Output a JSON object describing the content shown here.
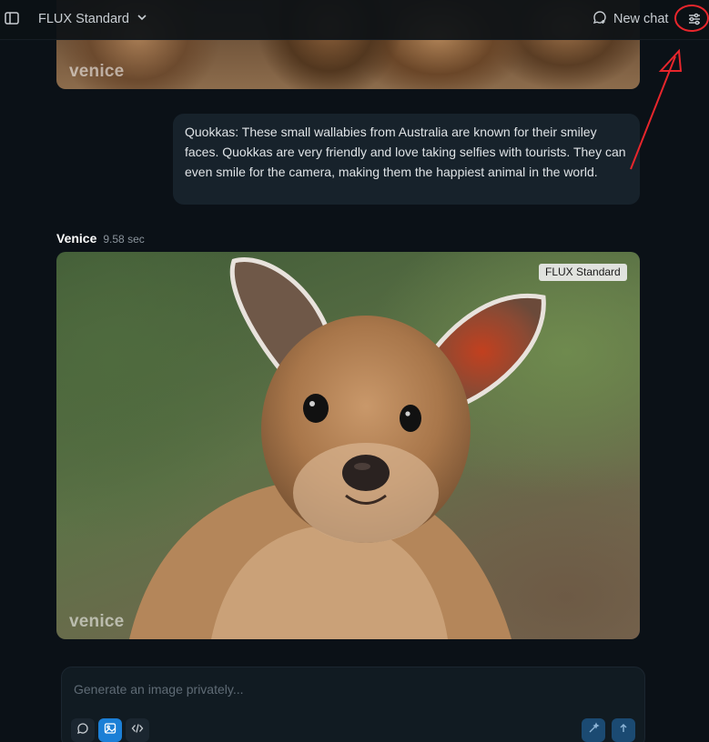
{
  "header": {
    "model_name": "FLUX Standard",
    "new_chat_label": "New chat"
  },
  "previous_image": {
    "watermark": "venice"
  },
  "user_message": {
    "text": "Quokkas: These small wallabies from Australia are known for their smiley faces. Quokkas are very friendly and love taking selfies with tourists. They can even smile for the camera, making them the happiest animal in the world."
  },
  "assistant": {
    "name": "Venice",
    "duration": "9.58 sec",
    "image_badge": "FLUX Standard",
    "image_watermark": "venice"
  },
  "composer": {
    "placeholder": "Generate an image privately...",
    "modes": [
      {
        "icon": "chat-bubble-icon",
        "active": false
      },
      {
        "icon": "image-icon",
        "active": true
      },
      {
        "icon": "code-icon",
        "active": false
      }
    ]
  },
  "colors": {
    "background": "#0b1117",
    "user_bubble": "#17222b",
    "active_mode": "#1c7fd6",
    "annotation_red": "#e8262c"
  }
}
